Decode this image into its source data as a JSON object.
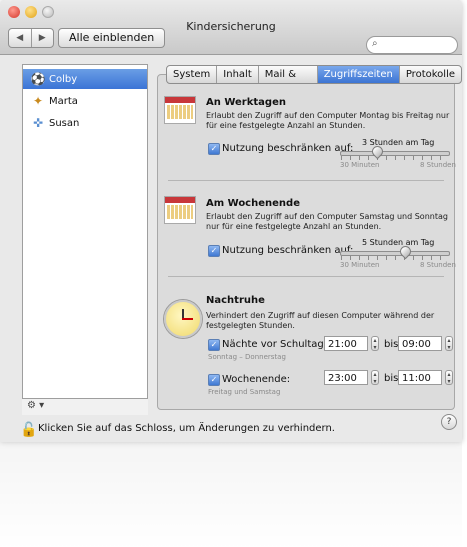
{
  "window": {
    "title": "Kindersicherung"
  },
  "toolbar": {
    "back_icon": "triangle-left",
    "forward_icon": "triangle-right",
    "show_all_label": "Alle einblenden",
    "search_icon": "magnifier",
    "search_value": ""
  },
  "sidebar": {
    "items": [
      {
        "label": "Colby",
        "icon": "soccer-ball",
        "selected": true
      },
      {
        "label": "Marta",
        "icon": "butterfly",
        "selected": false
      },
      {
        "label": "Susan",
        "icon": "dragonfly",
        "selected": false
      }
    ],
    "footer_icon": "gear-dropdown"
  },
  "tabs": [
    {
      "label": "System",
      "active": false
    },
    {
      "label": "Inhalt",
      "active": false
    },
    {
      "label": "Mail & iChat",
      "active": false
    },
    {
      "label": "Zugriffszeiten",
      "active": true
    },
    {
      "label": "Protokolle",
      "active": false
    }
  ],
  "weekdays": {
    "title": "An Werktagen",
    "description": "Erlaubt den Zugriff auf den Computer Montag bis Freitag nur für eine festgelegte Anzahl an Stunden.",
    "checkbox_label": "Nutzung beschränken auf:",
    "checked": true,
    "slider_value": "3 Stunden am Tag",
    "slider_level": 0.2,
    "min_label": "30 Minuten",
    "max_label": "8 Stunden"
  },
  "weekend": {
    "title": "Am Wochenende",
    "description": "Erlaubt den Zugriff auf den Computer Samstag und Sonntag nur für eine festgelegte Anzahl an Stunden.",
    "checkbox_label": "Nutzung beschränken auf:",
    "checked": true,
    "slider_value": "5 Stunden am Tag",
    "slider_level": 0.6,
    "min_label": "30 Minuten",
    "max_label": "8 Stunden"
  },
  "bedtime": {
    "title": "Nachtruhe",
    "description": "Verhindert den Zugriff auf diesen Computer während der festgelegten Stunden.",
    "school_nights": {
      "label": "Nächte vor Schultagen:",
      "sublabel": "Sonntag – Donnerstag",
      "checked": true,
      "from": "21:00",
      "to_label": "bis",
      "to": "09:00"
    },
    "weekend_nights": {
      "label": "Wochenende:",
      "sublabel": "Freitag und Samstag",
      "checked": true,
      "from": "23:00",
      "to_label": "bis",
      "to": "11:00"
    }
  },
  "footer": {
    "lock_text": "Klicken Sie auf das Schloss, um Änderungen zu verhindern.",
    "lock_icon": "padlock-open",
    "help_label": "?"
  }
}
